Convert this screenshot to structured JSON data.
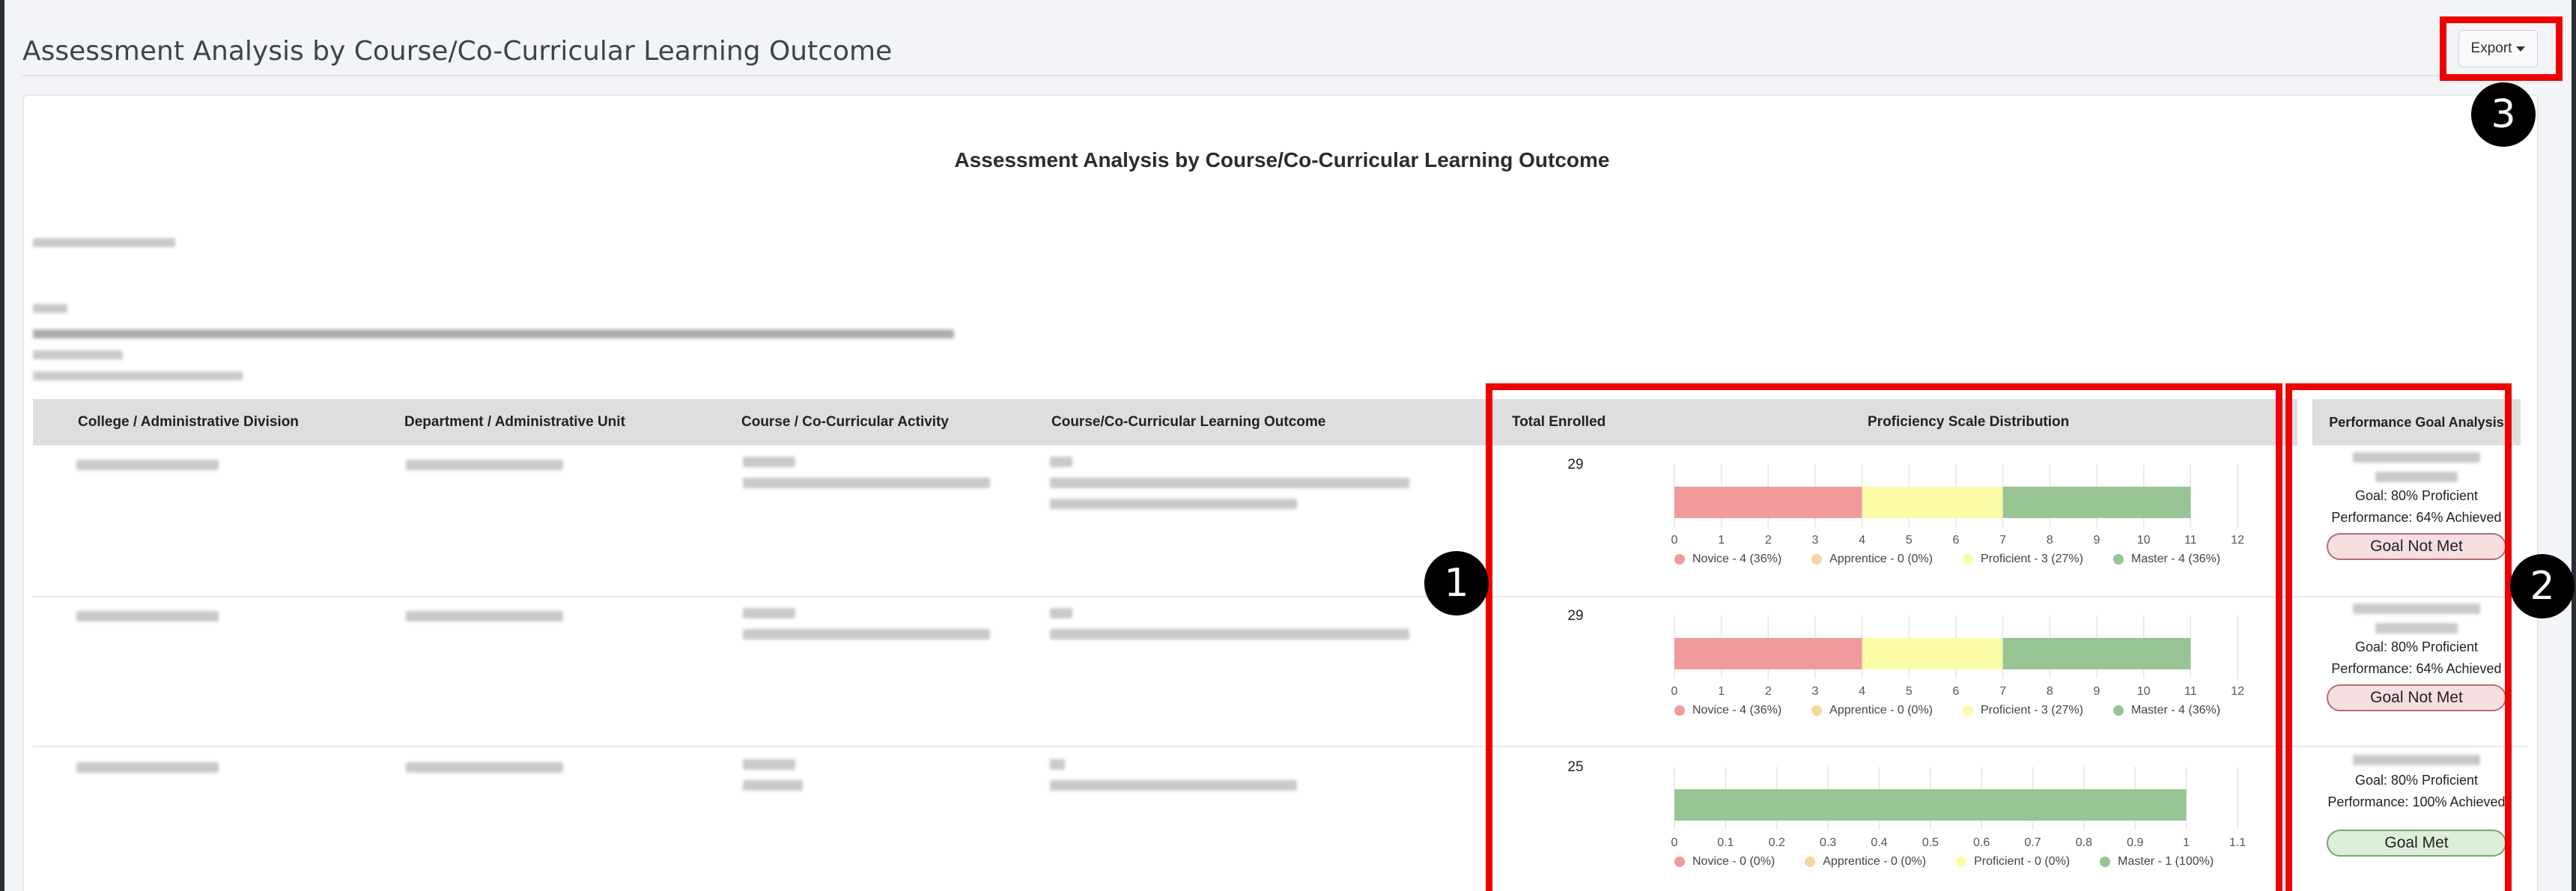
{
  "page": {
    "title": "Assessment Analysis by Course/Co-Curricular Learning Outcome"
  },
  "toolbar": {
    "export_label": "Export"
  },
  "report": {
    "title": "Assessment Analysis by Course/Co-Curricular Learning Outcome"
  },
  "table": {
    "headers": {
      "college": "College / Administrative Division",
      "department": "Department / Administrative Unit",
      "course": "Course / Co-Curricular Activity",
      "outcome": "Course/Co-Curricular Learning Outcome",
      "enrolled": "Total Enrolled",
      "distribution": "Proficiency Scale Distribution",
      "goal": "Performance Goal Analysis"
    },
    "rows": [
      {
        "enrolled": "29",
        "goal_line": "Goal: 80% Proficient",
        "performance_line": "Performance: 64% Achieved",
        "status": "Goal Not Met",
        "status_type": "not-met",
        "chart": {
          "type": "bar",
          "orientation": "horizontal-stacked",
          "x_ticks": [
            "0",
            "1",
            "2",
            "3",
            "4",
            "5",
            "6",
            "7",
            "8",
            "9",
            "10",
            "11",
            "12"
          ],
          "xlim": [
            0,
            12
          ],
          "segments": [
            {
              "name": "Novice",
              "value": 4,
              "color": "#f19a9a"
            },
            {
              "name": "Apprentice",
              "value": 0,
              "color": "#f5d79e"
            },
            {
              "name": "Proficient",
              "value": 3,
              "color": "#fbfba8"
            },
            {
              "name": "Master",
              "value": 4,
              "color": "#98c495"
            }
          ],
          "legend": [
            "Novice - 4 (36%)",
            "Apprentice - 0 (0%)",
            "Proficient - 3 (27%)",
            "Master - 4 (36%)"
          ]
        }
      },
      {
        "enrolled": "29",
        "goal_line": "Goal: 80% Proficient",
        "performance_line": "Performance: 64% Achieved",
        "status": "Goal Not Met",
        "status_type": "not-met",
        "chart": {
          "type": "bar",
          "orientation": "horizontal-stacked",
          "x_ticks": [
            "0",
            "1",
            "2",
            "3",
            "4",
            "5",
            "6",
            "7",
            "8",
            "9",
            "10",
            "11",
            "12"
          ],
          "xlim": [
            0,
            12
          ],
          "segments": [
            {
              "name": "Novice",
              "value": 4,
              "color": "#f19a9a"
            },
            {
              "name": "Apprentice",
              "value": 0,
              "color": "#f5d79e"
            },
            {
              "name": "Proficient",
              "value": 3,
              "color": "#fbfba8"
            },
            {
              "name": "Master",
              "value": 4,
              "color": "#98c495"
            }
          ],
          "legend": [
            "Novice - 4 (36%)",
            "Apprentice - 0 (0%)",
            "Proficient - 3 (27%)",
            "Master - 4 (36%)"
          ]
        }
      },
      {
        "enrolled": "25",
        "goal_line": "Goal: 80% Proficient",
        "performance_line": "Performance: 100% Achieved",
        "status": "Goal Met",
        "status_type": "met",
        "chart": {
          "type": "bar",
          "orientation": "horizontal-stacked",
          "x_ticks": [
            "0",
            "0.1",
            "0.2",
            "0.3",
            "0.4",
            "0.5",
            "0.6",
            "0.7",
            "0.8",
            "0.9",
            "1",
            "1.1"
          ],
          "xlim": [
            0,
            1.1
          ],
          "segments": [
            {
              "name": "Novice",
              "value": 0,
              "color": "#f19a9a"
            },
            {
              "name": "Apprentice",
              "value": 0,
              "color": "#f5d79e"
            },
            {
              "name": "Proficient",
              "value": 0,
              "color": "#fbfba8"
            },
            {
              "name": "Master",
              "value": 1,
              "color": "#98c495"
            }
          ],
          "legend": [
            "Novice - 0 (0%)",
            "Apprentice - 0 (0%)",
            "Proficient - 0 (0%)",
            "Master - 1 (100%)"
          ]
        }
      }
    ]
  },
  "callouts": [
    "1",
    "2",
    "3"
  ],
  "colors": {
    "highlight": "#ee0000",
    "accent": "#3d4450"
  }
}
